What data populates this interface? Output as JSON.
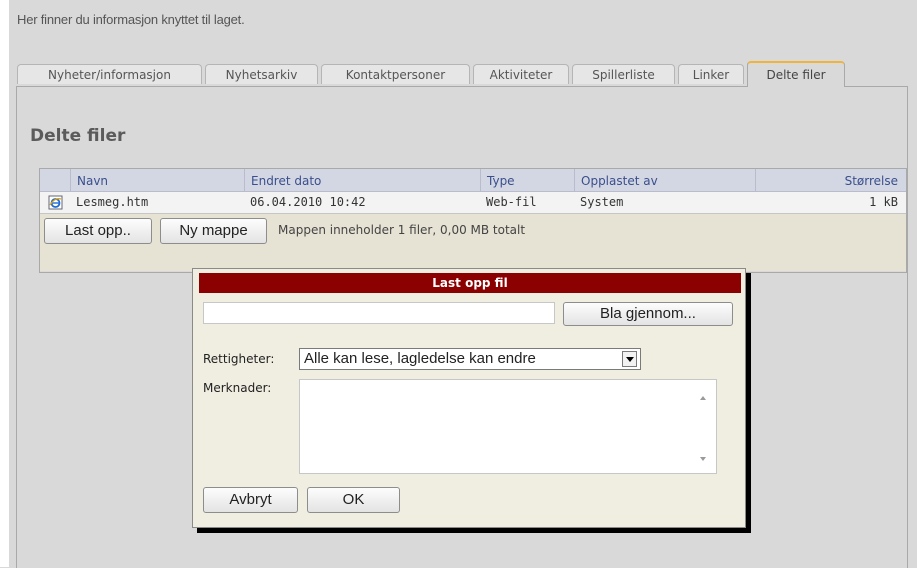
{
  "intro_text": "Her finner du informasjon knyttet til laget.",
  "tabs": [
    {
      "label": "Nyheter/informasjon"
    },
    {
      "label": "Nyhetsarkiv"
    },
    {
      "label": "Kontaktpersoner"
    },
    {
      "label": "Aktiviteter"
    },
    {
      "label": "Spillerliste"
    },
    {
      "label": "Linker"
    },
    {
      "label": "Delte filer",
      "active": true
    }
  ],
  "section_title": "Delte filer",
  "table": {
    "headers": [
      "Navn",
      "Endret dato",
      "Type",
      "Opplastet av",
      "Størrelse"
    ],
    "rows": [
      {
        "icon": "ie-file-icon",
        "name": "Lesmeg.htm",
        "date": "06.04.2010 10:42",
        "type": "Web-fil",
        "uploaded_by": "System",
        "size": "1 kB"
      }
    ]
  },
  "toolbar": {
    "upload_label": "Last opp..",
    "new_folder_label": "Ny mappe",
    "info": "Mappen inneholder 1 filer, 0,00 MB totalt"
  },
  "dialog": {
    "title": "Last opp fil",
    "file_path_value": "",
    "browse_label": "Bla gjennom...",
    "rights_label": "Rettigheter:",
    "rights_value": "Alle kan lese, lagledelse kan endre",
    "notes_label": "Merknader:",
    "notes_value": "",
    "cancel_label": "Avbryt",
    "ok_label": "OK"
  },
  "colors": {
    "dialog_title_bg": "#8b0000",
    "active_tab_accent": "#f0b43c",
    "header_text": "#3a4f8c"
  }
}
